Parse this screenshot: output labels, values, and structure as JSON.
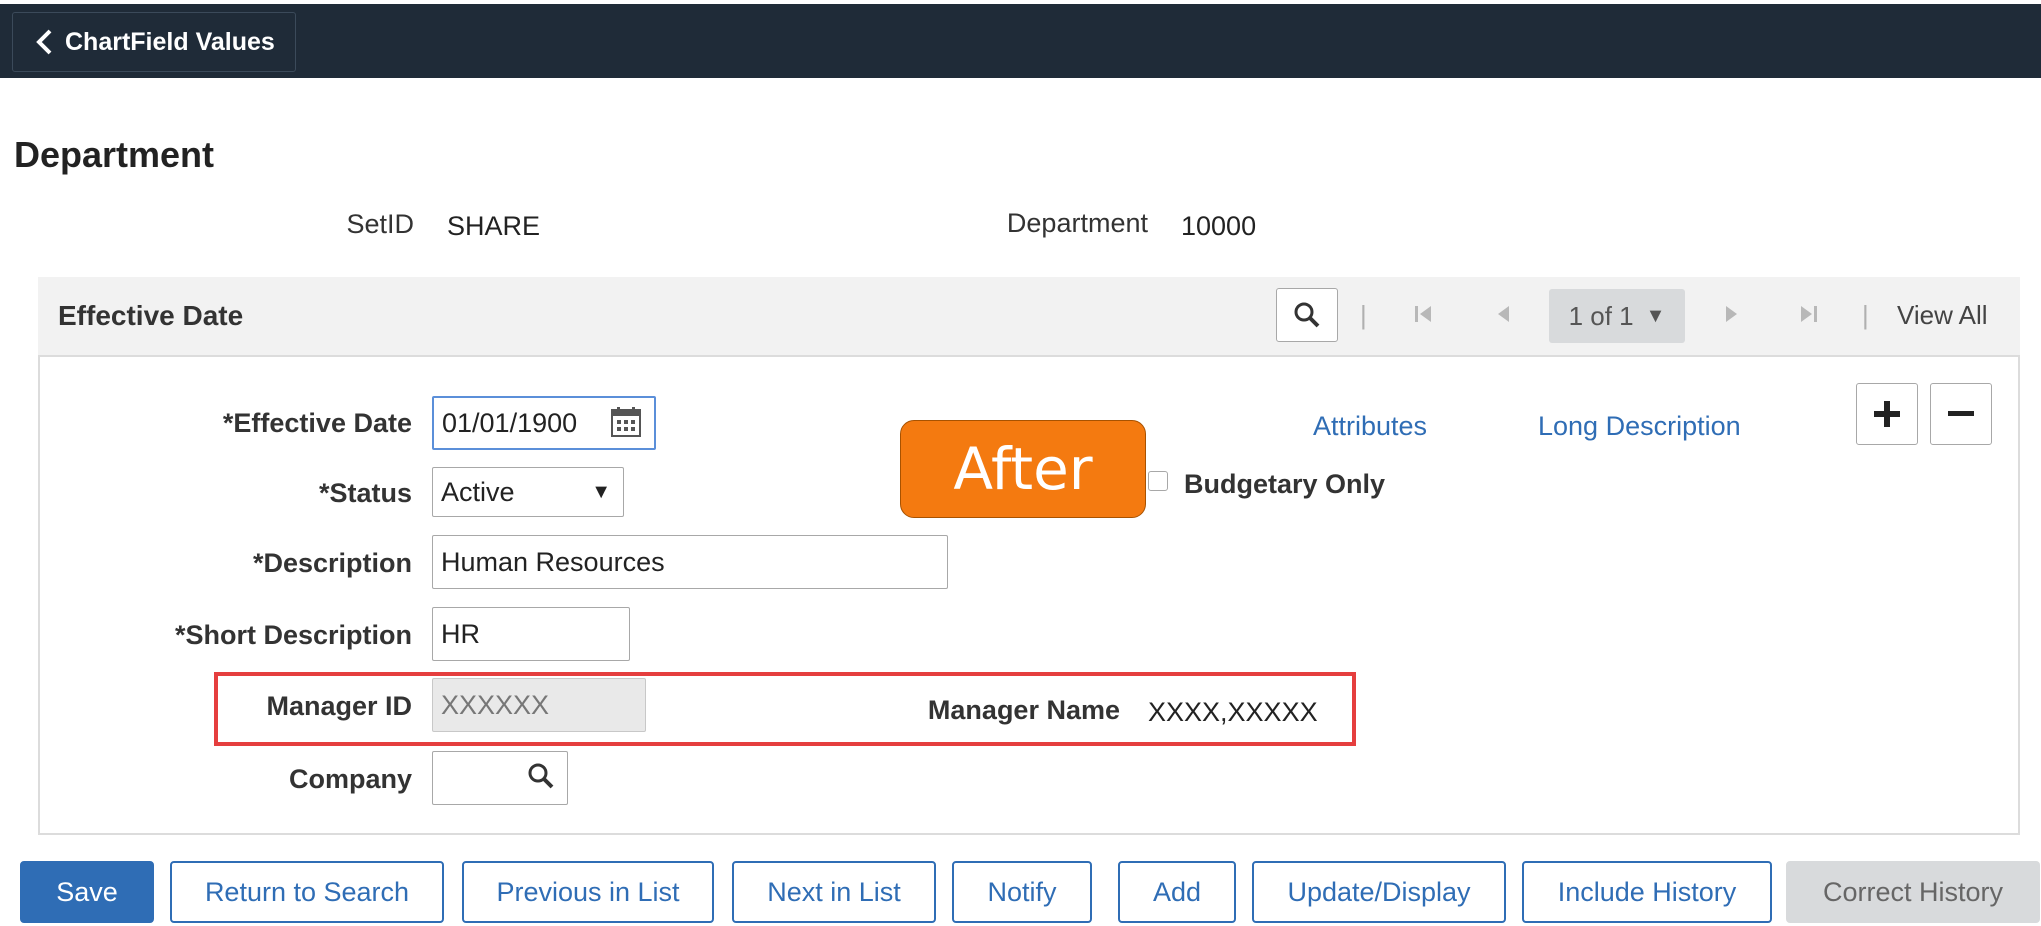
{
  "header": {
    "back_label": "ChartField Values"
  },
  "page": {
    "title": "Department"
  },
  "keys": {
    "setid_label": "SetID",
    "setid_value": "SHARE",
    "department_label": "Department",
    "department_value": "10000"
  },
  "effective_date_panel": {
    "title": "Effective Date",
    "pager": "1 of 1",
    "pager_arrow": "▼",
    "view_all": "View All"
  },
  "form": {
    "effective_date_label": "*Effective Date",
    "effective_date_value": "01/01/1900",
    "status_label": "*Status",
    "status_value": "Active",
    "description_label": "*Description",
    "description_value": "Human Resources",
    "short_description_label": "*Short Description",
    "short_description_value": "HR",
    "manager_id_label": "Manager ID",
    "manager_id_value": "XXXXXX",
    "manager_name_label": "Manager Name",
    "manager_name_value": "XXXX,XXXXX",
    "company_label": "Company",
    "budgetary_only_label": "Budgetary Only",
    "attributes_link": "Attributes",
    "long_description_link": "Long Description"
  },
  "annotation": {
    "after_label": "After"
  },
  "colors": {
    "topbar": "#1f2b38",
    "accent": "#2f6db5",
    "annotation": "#f47a10",
    "highlight": "#e53e3e"
  },
  "buttons": {
    "save": "Save",
    "return_to_search": "Return to Search",
    "previous_in_list": "Previous in List",
    "next_in_list": "Next in List",
    "notify": "Notify",
    "add": "Add",
    "update_display": "Update/Display",
    "include_history": "Include History",
    "correct_history": "Correct History"
  }
}
